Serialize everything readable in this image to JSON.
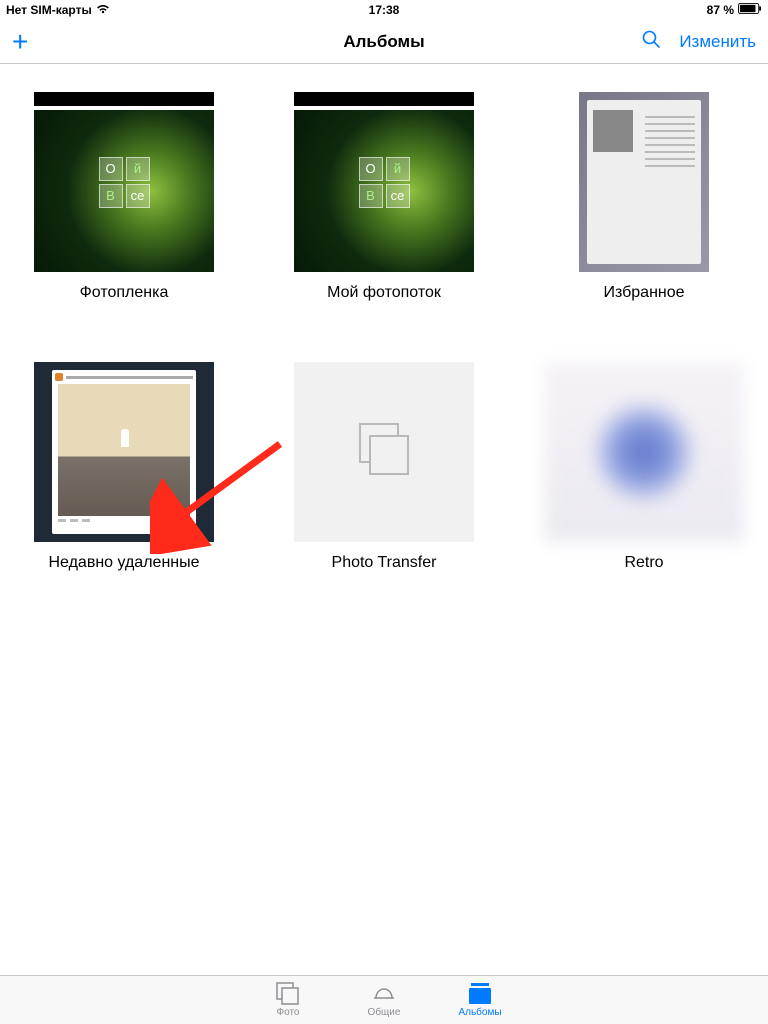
{
  "status": {
    "carrier": "Нет SIM-карты",
    "time": "17:38",
    "battery_pct": "87 %"
  },
  "nav": {
    "title": "Альбомы",
    "edit": "Изменить"
  },
  "albums": [
    {
      "id": "camera-roll",
      "title": "Фотопленка"
    },
    {
      "id": "photostream",
      "title": "Мой фотопоток"
    },
    {
      "id": "favorites",
      "title": "Избранное"
    },
    {
      "id": "recently-deleted",
      "title": "Недавно удаленные"
    },
    {
      "id": "photo-transfer",
      "title": "Photo Transfer"
    },
    {
      "id": "retro",
      "title": "Retro"
    }
  ],
  "smoke_tiles": [
    "О",
    "й",
    "В",
    "се"
  ],
  "tabs": {
    "photos": "Фото",
    "shared": "Общие",
    "albums": "Альбомы"
  },
  "colors": {
    "tint": "#007aff"
  }
}
